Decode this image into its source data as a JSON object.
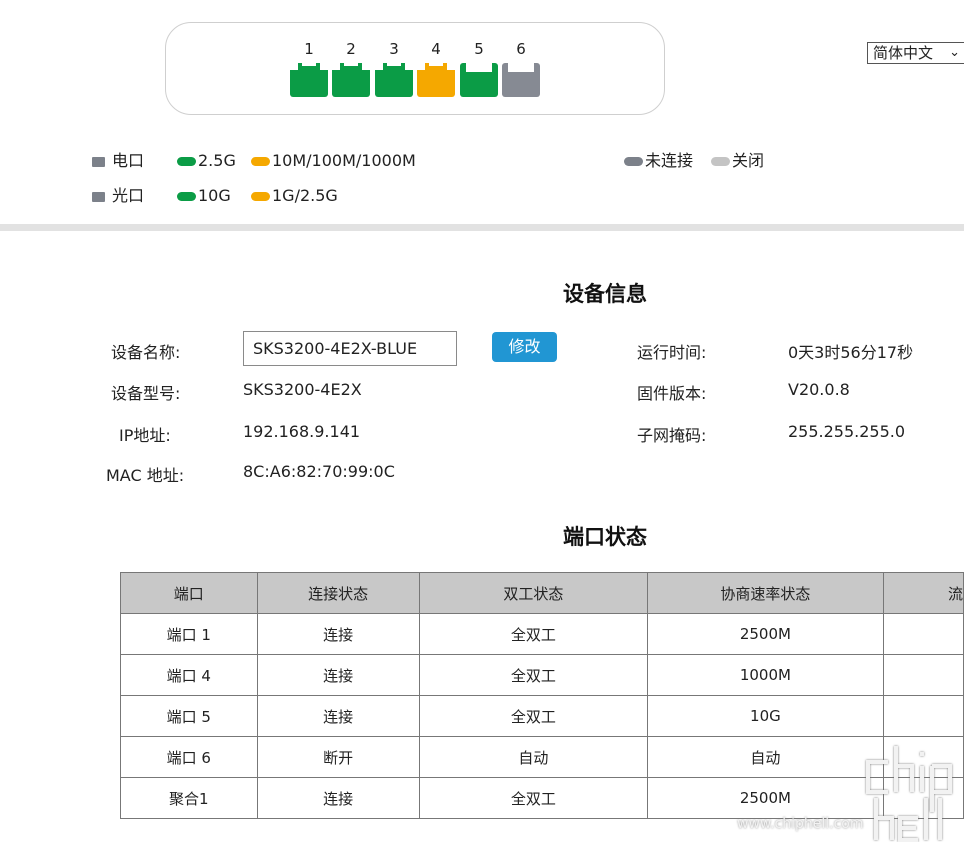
{
  "ports": [
    {
      "num": "1",
      "color": "#0b9c46",
      "kind": "rj"
    },
    {
      "num": "2",
      "color": "#0b9c46",
      "kind": "rj"
    },
    {
      "num": "3",
      "color": "#0b9c46",
      "kind": "rj"
    },
    {
      "num": "4",
      "color": "#f5a800",
      "kind": "rj"
    },
    {
      "num": "5",
      "color": "#0b9c46",
      "kind": "sfp"
    },
    {
      "num": "6",
      "color": "#868a93",
      "kind": "sfp"
    }
  ],
  "language": {
    "selected": "简体中文"
  },
  "legend": {
    "electric": "电口",
    "optical": "光口",
    "e_fast": "2.5G",
    "e_slow": "10M/100M/1000M",
    "o_fast": "10G",
    "o_slow": "1G/2.5G",
    "disconnected": "未连接",
    "off": "关闭",
    "colors": {
      "green": "#0b9c46",
      "orange": "#f5a800",
      "gray": "#7c818a",
      "light": "#c4c4c4"
    }
  },
  "device": {
    "title": "设备信息",
    "name_label": "设备名称:",
    "name_value": "SKS3200-4E2X-BLUE",
    "modify": "修改",
    "model_label": "设备型号:",
    "model_value": "SKS3200-4E2X",
    "ip_label": "IP地址:",
    "ip_value": "192.168.9.141",
    "mac_label": "MAC 地址:",
    "mac_value": "8C:A6:82:70:99:0C",
    "uptime_label": "运行时间:",
    "uptime_value": "0天3时56分17秒",
    "fw_label": "固件版本:",
    "fw_value": "V20.0.8",
    "mask_label": "子网掩码:",
    "mask_value": "255.255.255.0"
  },
  "port_status": {
    "title": "端口状态",
    "headers": [
      "端口",
      "连接状态",
      "双工状态",
      "协商速率状态",
      "流"
    ],
    "rows": [
      [
        "端口 1",
        "连接",
        "全双工",
        "2500M",
        ""
      ],
      [
        "端口 4",
        "连接",
        "全双工",
        "1000M",
        ""
      ],
      [
        "端口 5",
        "连接",
        "全双工",
        "10G",
        ""
      ],
      [
        "端口 6",
        "断开",
        "自动",
        "自动",
        ""
      ],
      [
        "聚合1",
        "连接",
        "全双工",
        "2500M",
        ""
      ]
    ]
  },
  "watermark": {
    "url": "www.chiphell.com",
    "logo": "chip hell"
  }
}
